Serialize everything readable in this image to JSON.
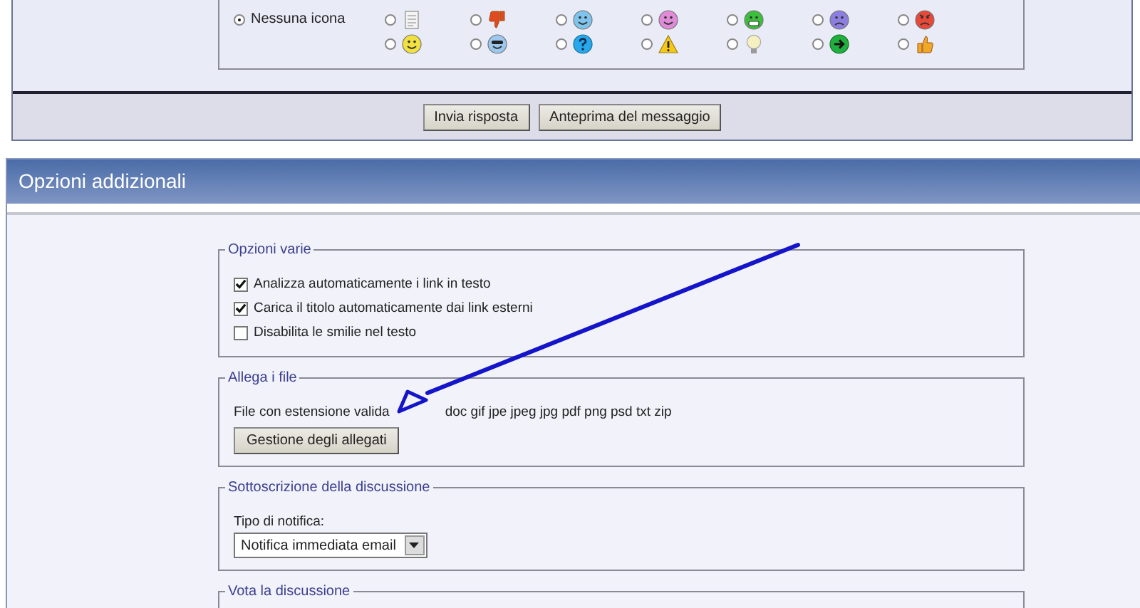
{
  "post_icons": {
    "none_option": {
      "label": "Nessuna icona",
      "selected": true
    },
    "icons": [
      {
        "kind": "document",
        "selected": false
      },
      {
        "kind": "thumbs-down",
        "selected": false,
        "color": "#e04a20"
      },
      {
        "kind": "wink",
        "selected": false,
        "color": "#7ec4ec"
      },
      {
        "kind": "smile",
        "selected": false,
        "color": "#e08ad8"
      },
      {
        "kind": "grin",
        "selected": false,
        "color": "#3cc03c"
      },
      {
        "kind": "sad",
        "selected": false,
        "color": "#8c7ee0"
      },
      {
        "kind": "angry",
        "selected": false,
        "color": "#e84838"
      },
      {
        "kind": "smile",
        "selected": false,
        "color": "#f0e040"
      },
      {
        "kind": "cool",
        "selected": false,
        "color": "#9cc8f0"
      },
      {
        "kind": "question",
        "selected": false,
        "color": "#28a8e8"
      },
      {
        "kind": "warning",
        "selected": false,
        "color": "#f4c818"
      },
      {
        "kind": "bulb",
        "selected": false,
        "color": "#f4f0c0"
      },
      {
        "kind": "arrow",
        "selected": false,
        "color": "#20b040"
      },
      {
        "kind": "thumbs-up",
        "selected": false,
        "color": "#f0a828"
      }
    ]
  },
  "buttons": [
    "Invia risposta",
    "Anteprima del messaggio"
  ],
  "additional_options": {
    "title": "Opzioni addizionali",
    "groups": [
      {
        "kind": "checkboxes",
        "legend": "Opzioni varie",
        "options": [
          {
            "label": "Analizza automaticamente i link in testo",
            "checked": true
          },
          {
            "label": "Carica il titolo automaticamente dai link esterni",
            "checked": true
          },
          {
            "label": "Disabilita le smilie nel testo",
            "checked": false
          }
        ]
      },
      {
        "kind": "attachments",
        "legend": "Allega i file",
        "text": [
          "File con estensione valida",
          "doc gif jpe jpeg jpg pdf png psd txt zip"
        ],
        "button": "Gestione degli allegati"
      },
      {
        "kind": "subscription",
        "legend": "Sottoscrizione della discussione",
        "field_label": "Tipo di notifica:",
        "value": "Notifica immediata email"
      },
      {
        "kind": "vote",
        "legend": "Vota la discussione"
      }
    ]
  }
}
